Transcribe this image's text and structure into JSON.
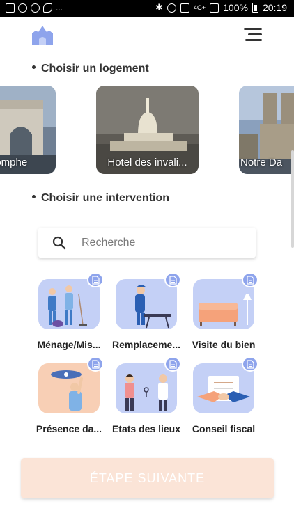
{
  "status_bar": {
    "battery_text": "100%",
    "time": "20:19",
    "signal_text": "4G+",
    "dots": "..."
  },
  "sections": {
    "logement_title": "Choisir un logement",
    "intervention_title": "Choisir une intervention"
  },
  "logements": [
    {
      "label": "Arc de Triomphe",
      "visible_label": "iomphe"
    },
    {
      "label": "Hotel des invalides",
      "visible_label": "Hotel des invali..."
    },
    {
      "label": "Notre Dame",
      "visible_label": "Notre Da"
    }
  ],
  "search": {
    "placeholder": "Recherche",
    "value": ""
  },
  "services": [
    {
      "label": "Ménage/Mis...",
      "icon": "cleaning-illustration",
      "tile_color": "#c4d0f6"
    },
    {
      "label": "Remplaceme...",
      "icon": "ironing-illustration",
      "tile_color": "#c4d0f6"
    },
    {
      "label": "Visite du bien",
      "icon": "sofa-illustration",
      "tile_color": "#c4d0f6"
    },
    {
      "label": "Présence da...",
      "icon": "repair-illustration",
      "tile_color": "#f8cfb5"
    },
    {
      "label": "Etats des lieux",
      "icon": "key-handover-illustration",
      "tile_color": "#c4d0f6"
    },
    {
      "label": "Conseil fiscal",
      "icon": "handshake-illustration",
      "tile_color": "#c4d0f6"
    }
  ],
  "next_button": {
    "label": "ÉTAPE SUIVANTE"
  },
  "colors": {
    "accent": "#8ea4ec",
    "tile_blue": "#c4d0f6",
    "tile_peach": "#f8cfb5",
    "button_bg": "#fbe4d7"
  }
}
